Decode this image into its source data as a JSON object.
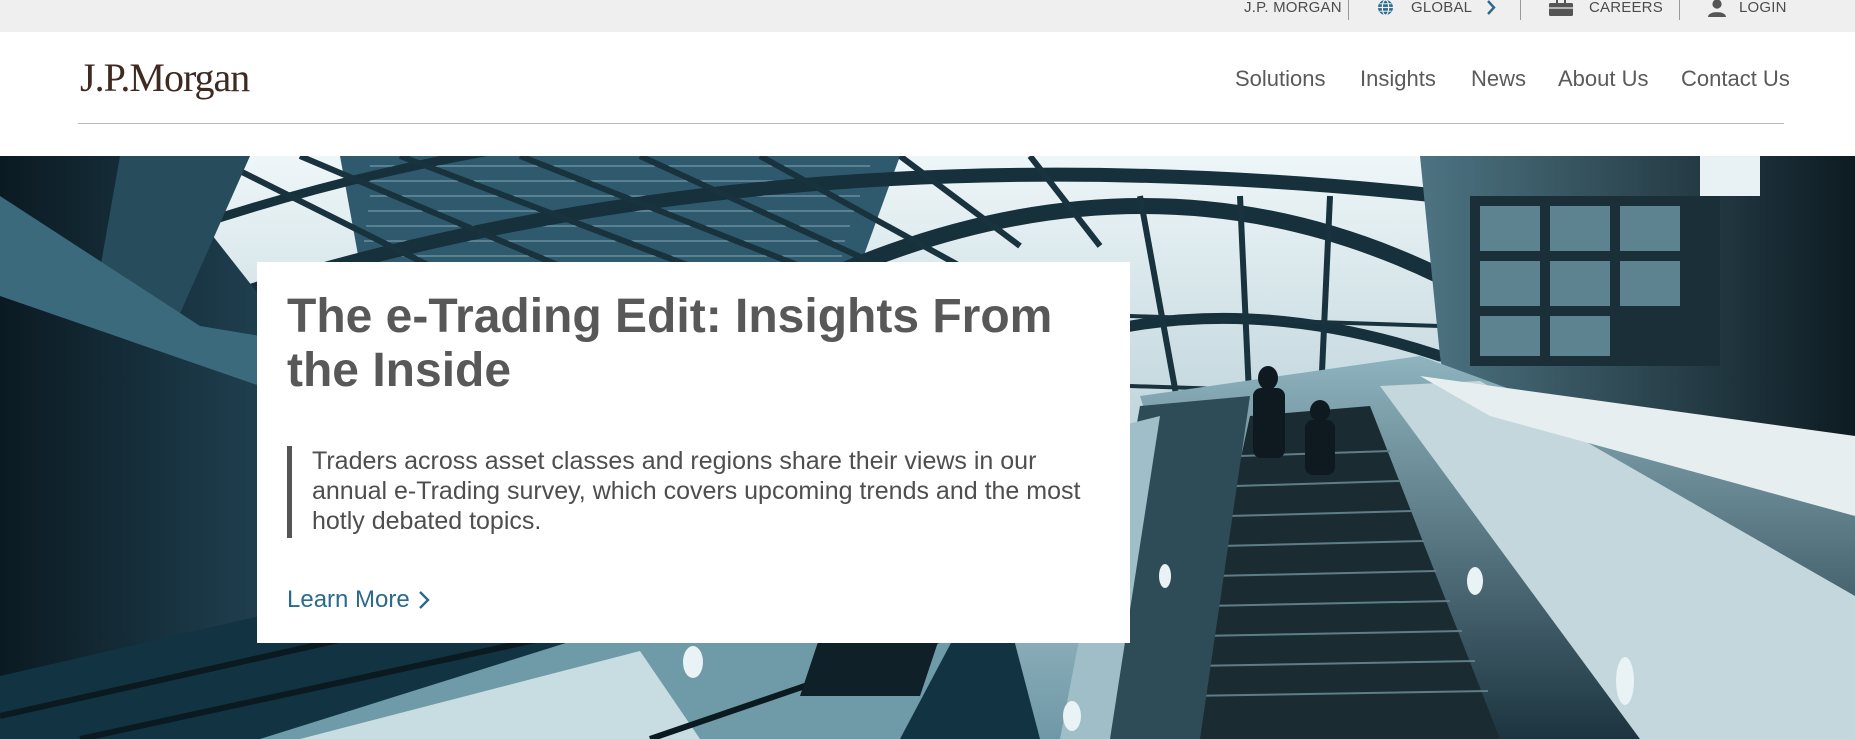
{
  "utility_bar": {
    "jpmorgan_label": "J.P. MORGAN",
    "global_label": "GLOBAL",
    "careers_label": "CAREERS",
    "login_label": "LOGIN"
  },
  "header": {
    "logo_text": "J.P.Morgan",
    "nav": {
      "solutions": "Solutions",
      "insights": "Insights",
      "news": "News",
      "about": "About Us",
      "contact": "Contact Us"
    }
  },
  "hero": {
    "title": "The e-Trading Edit: Insights From the Inside",
    "description": "Traders across asset classes and regions share their views in our annual e-Trading survey, which covers upcoming trends and the most hotly debated topics.",
    "cta_label": "Learn More"
  },
  "colors": {
    "brand_brown": "#3f2a22",
    "link_blue": "#2a6a8c",
    "utility_bg": "#f0eff0",
    "text_gray": "#585858"
  },
  "icons": {
    "global": "globe-icon",
    "global_chevron": "chevron-right-icon",
    "careers": "briefcase-icon",
    "login": "user-icon",
    "cta": "chevron-right-icon"
  }
}
